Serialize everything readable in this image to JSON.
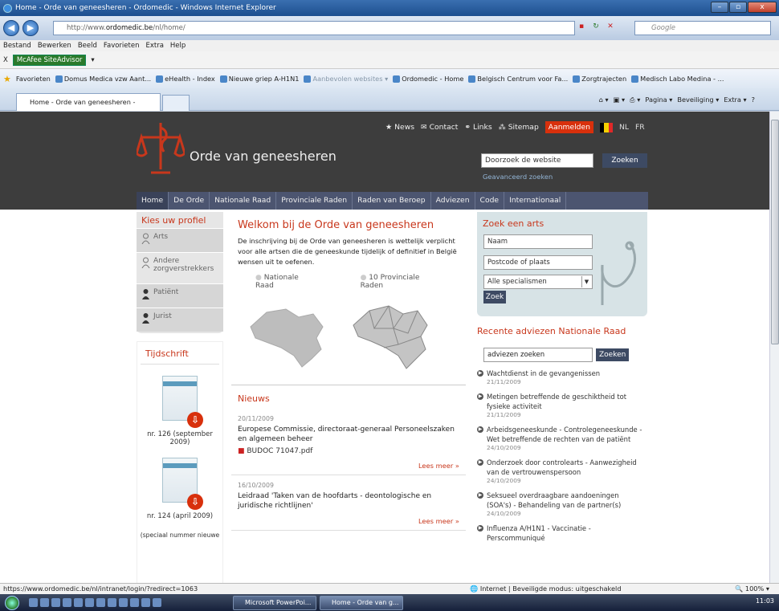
{
  "window": {
    "title": "Home - Orde van geneesheren - Ordomedic - Windows Internet Explorer",
    "min": "–",
    "max": "▫",
    "close": "x"
  },
  "browser": {
    "url_prefix": "http://www.",
    "url_domain": "ordomedic.be",
    "url_path": "/nl/home/",
    "search_placeholder": "Google"
  },
  "menu": [
    "Bestand",
    "Bewerken",
    "Beeld",
    "Favorieten",
    "Extra",
    "Help"
  ],
  "mcafee": {
    "label": "McAfee SiteAdvisor"
  },
  "favorites": {
    "label": "Favorieten",
    "items": [
      "Domus Medica vzw Aant...",
      "eHealth - Index",
      "Nieuwe griep A-H1N1",
      "Aanbevolen websites ▾",
      "Ordomedic - Home",
      "Belgisch Centrum voor Fa...",
      "Zorgtrajecten",
      "Medisch Labo Medina - ..."
    ]
  },
  "tab": {
    "title": "Home - Orde van geneesheren - Ordomedic"
  },
  "toolbar": {
    "page": "Pagina ▾",
    "security": "Beveiliging ▾",
    "extra": "Extra ▾"
  },
  "site": {
    "topnav": {
      "news": "News",
      "contact": "Contact",
      "links": "Links",
      "sitemap": "Sitemap",
      "login": "Aanmelden",
      "nl": "NL",
      "fr": "FR"
    },
    "name": "Orde van geneesheren",
    "search_value": "Doorzoek de website",
    "search_button": "Zoeken",
    "advanced": "Geavanceerd zoeken",
    "mainnav": [
      "Home",
      "De Orde",
      "Nationale Raad",
      "Provinciale Raden",
      "Raden van Beroep",
      "Adviezen",
      "Code",
      "Internationaal"
    ],
    "profile": {
      "title": "Kies uw profiel",
      "items": [
        "Arts",
        "Andere zorgverstrekkers",
        "Patiënt",
        "Jurist"
      ]
    },
    "tijdschrift": {
      "title": "Tijdschrift",
      "issues": [
        "nr. 126 (september 2009)",
        "nr. 124 (april 2009)",
        "(speciaal nummer nieuwe"
      ]
    },
    "welcome": {
      "title": "Welkom bij de Orde van geneesheren",
      "intro": "De inschrijving bij de Orde van geneesheren is wettelijk verplicht voor alle artsen die de geneeskunde tijdelijk of definitief in België wensen uit te oefenen.",
      "link1": "Nationale Raad",
      "link2": "10 Provinciale Raden"
    },
    "news": {
      "title": "Nieuws",
      "read_more": "Lees meer »",
      "items": [
        {
          "date": "20/11/2009",
          "title": "Europese Commissie, directoraat-generaal Personeelszaken en algemeen beheer",
          "pdf": "BUDOC 71047.pdf"
        },
        {
          "date": "16/10/2009",
          "title": "Leidraad 'Taken van de hoofdarts - deontologische en juridische richtlijnen'"
        }
      ]
    },
    "zoekarts": {
      "title": "Zoek een arts",
      "naam": "Naam",
      "postcode": "Postcode of plaats",
      "specialism": "Alle specialismen",
      "button": "Zoek"
    },
    "recent": {
      "title": "Recente adviezen Nationale Raad",
      "search_value": "adviezen zoeken",
      "search_button": "Zoeken",
      "items": [
        {
          "title": "Wachtdienst in de gevangenissen",
          "date": "21/11/2009"
        },
        {
          "title": "Metingen betreffende de geschiktheid tot fysieke activiteit",
          "date": "21/11/2009"
        },
        {
          "title": "Arbeidsgeneeskunde - Controlegeneeskunde - Wet betreffende de rechten van de patiënt",
          "date": "24/10/2009"
        },
        {
          "title": "Onderzoek door controlearts - Aanwezigheid van de vertrouwenspersoon",
          "date": "24/10/2009"
        },
        {
          "title": "Seksueel overdraagbare aandoeningen (SOA's) - Behandeling van de partner(s)",
          "date": "24/10/2009"
        },
        {
          "title": "Influenza A/H1N1 - Vaccinatie - Perscommuniqué",
          "date": ""
        }
      ]
    }
  },
  "status": {
    "url": "https://www.ordomedic.be/nl/intranet/login/?redirect=1063",
    "zone": "Internet | Beveiligde modus: uitgeschakeld",
    "zoom": "100%"
  },
  "taskbar": {
    "btn1": "Microsoft PowerPoi...",
    "btn2": "Home - Orde van g...",
    "clock": "11:03"
  }
}
